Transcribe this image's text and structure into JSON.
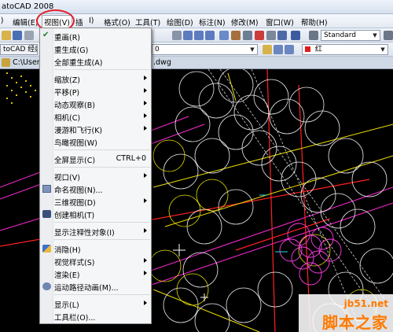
{
  "title_bar": {
    "title": "atoCAD 2008"
  },
  "menubar": {
    "items": [
      {
        "label": "I)"
      },
      {
        "label": "编辑(E)"
      },
      {
        "label": "视图(V)"
      },
      {
        "label": "插"
      },
      {
        "label": "I)"
      },
      {
        "label": "格式(O)"
      },
      {
        "label": "工具(T)"
      },
      {
        "label": "绘图(D)"
      },
      {
        "label": "标注(N)"
      },
      {
        "label": "修改(M)"
      },
      {
        "label": "窗口(W)"
      },
      {
        "label": "帮助(H)"
      }
    ]
  },
  "toolbar": {
    "text_style": "Standard",
    "workspace": "toCAD 经典",
    "layer": "0",
    "color": "红"
  },
  "document_tab": {
    "path_prefix": "C:\\Users",
    "file_suffix": ".dwg"
  },
  "view_menu": {
    "items": [
      {
        "label": "重画(R)",
        "icon": "redraw-icon"
      },
      {
        "label": "重生成(G)"
      },
      {
        "label": "全部重生成(A)"
      },
      {
        "separator": true
      },
      {
        "label": "缩放(Z)",
        "submenu": true
      },
      {
        "label": "平移(P)",
        "submenu": true
      },
      {
        "label": "动态观察(B)",
        "submenu": true
      },
      {
        "label": "相机(C)",
        "submenu": true
      },
      {
        "label": "漫游和飞行(K)",
        "submenu": true
      },
      {
        "label": "鸟瞰视图(W)",
        "icon": "aerial-view-icon"
      },
      {
        "separator": true
      },
      {
        "label": "全屏显示(C)",
        "shortcut": "CTRL+0"
      },
      {
        "separator": true
      },
      {
        "label": "视口(V)",
        "submenu": true
      },
      {
        "label": "命名视图(N)...",
        "icon": "named-view-icon"
      },
      {
        "label": "三维视图(D)",
        "submenu": true
      },
      {
        "label": "创建相机(T)",
        "icon": "camera-icon"
      },
      {
        "separator": true
      },
      {
        "label": "显示注释性对象(I)",
        "submenu": true
      },
      {
        "separator": true
      },
      {
        "label": "消隐(H)",
        "icon": "hide-icon"
      },
      {
        "label": "视觉样式(S)",
        "submenu": true
      },
      {
        "label": "渲染(E)",
        "submenu": true
      },
      {
        "label": "运动路径动画(M)...",
        "icon": "motion-path-icon"
      },
      {
        "separator": true
      },
      {
        "label": "显示(L)",
        "submenu": true
      },
      {
        "label": "工具栏(O)..."
      }
    ]
  },
  "watermark": {
    "line1": "jb51.net",
    "line2": "脚本之家"
  },
  "colors": {
    "highlight_ring": "#e0212b",
    "watermark": "#ff7a00"
  }
}
